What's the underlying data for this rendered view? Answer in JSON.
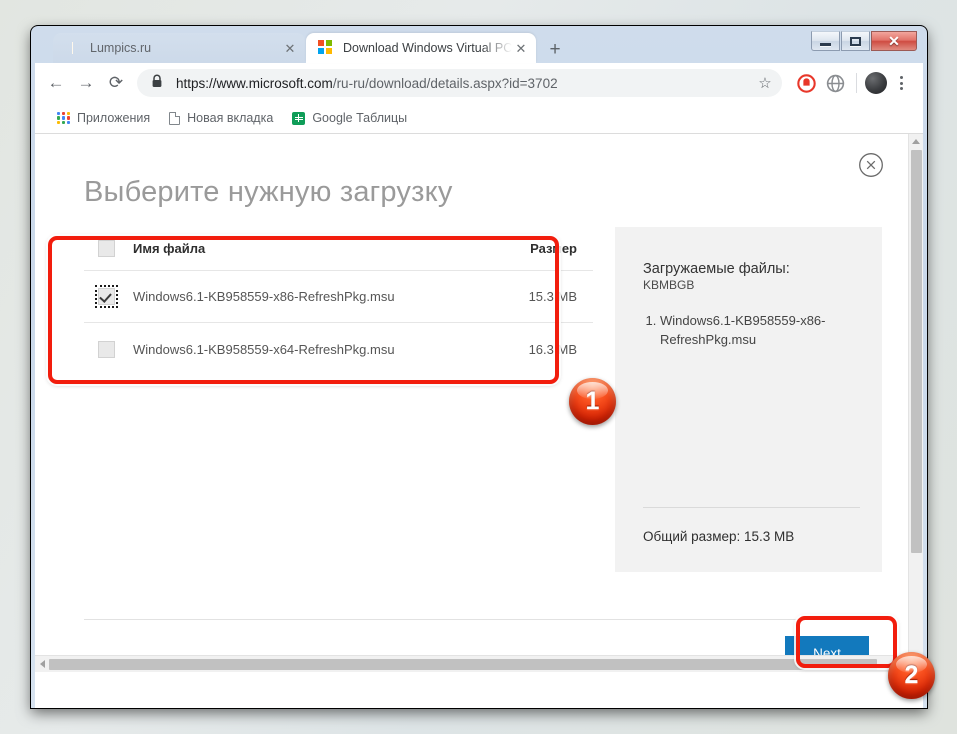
{
  "window": {
    "controls": {
      "minimize": "minimize",
      "maximize": "maximize",
      "close": "✕"
    }
  },
  "tabs": [
    {
      "title": "Lumpics.ru",
      "favicon": "orange-slice-favicon",
      "active": false,
      "close_label": "✕"
    },
    {
      "title": "Download Windows Virtual PC fr",
      "favicon": "microsoft-favicon",
      "active": true,
      "close_label": "✕"
    }
  ],
  "new_tab_label": "+",
  "toolbar": {
    "back_label": "←",
    "forward_label": "→",
    "reload_label": "⟳",
    "lock_icon": "lock-icon",
    "url": "https://www.microsoft.com/ru-ru/download/details.aspx?id=3702",
    "url_scheme": "https://",
    "url_host": "www.microsoft.com",
    "url_path": "/ru-ru/download/details.aspx?id=3702",
    "star_label": "☆",
    "extension_1": "adblock-extension-icon",
    "extension_2": "globe-extension-icon",
    "avatar": "user-avatar",
    "menu_label": "kebab-menu"
  },
  "bookmarks": [
    {
      "label": "Приложения",
      "icon": "apps-grid-icon"
    },
    {
      "label": "Новая вкладка",
      "icon": "document-icon"
    },
    {
      "label": "Google Таблицы",
      "icon": "google-sheets-icon"
    }
  ],
  "page": {
    "heading": "Выберите нужную загрузку",
    "close_button": "close-circle-icon",
    "table": {
      "headers": {
        "name": "Имя файла",
        "size": "Размер"
      },
      "rows": [
        {
          "name": "Windows6.1-KB958559-x86-RefreshPkg.msu",
          "size": "15.3 MB",
          "checked": true,
          "focused": true
        },
        {
          "name": "Windows6.1-KB958559-x64-RefreshPkg.msu",
          "size": "16.3 MB",
          "checked": false,
          "focused": false
        }
      ]
    },
    "info_panel": {
      "label": "Загружаемые файлы:",
      "sublabel": "KBMBGB",
      "items": [
        "Windows6.1-KB958559-x86-RefreshPkg.msu"
      ],
      "total_size": "Общий размер: 15.3 MB"
    },
    "next_button": "Next"
  },
  "annotations": [
    {
      "badge": "1",
      "target": "file-table"
    },
    {
      "badge": "2",
      "target": "next-button"
    }
  ],
  "colors": {
    "accent_blue": "#1279bd",
    "annotation_red": "#f21d0d",
    "badge_orange": "#fb5522",
    "panel_gray": "#f2f2f2",
    "heading_gray": "#9a9a9a"
  }
}
